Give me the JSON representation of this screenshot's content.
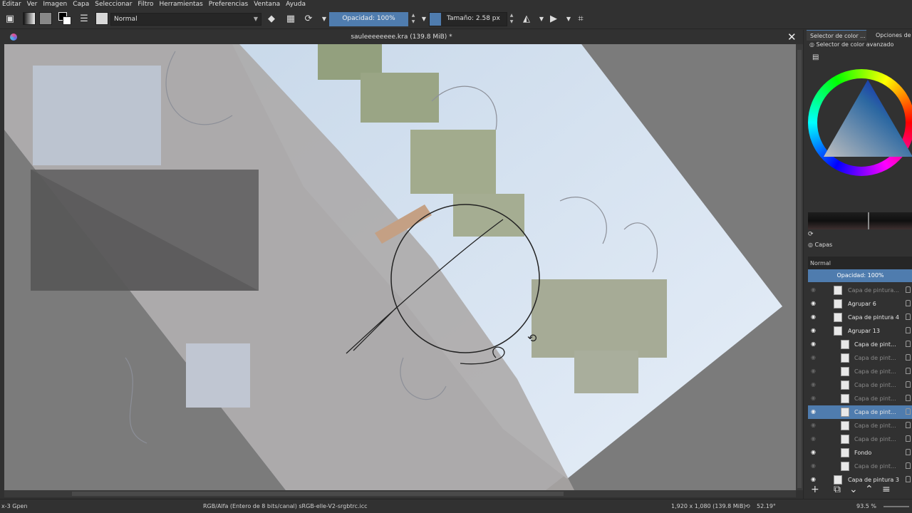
{
  "menu": [
    "Editar",
    "Ver",
    "Imagen",
    "Capa",
    "Seleccionar",
    "Filtro",
    "Herramientas",
    "Preferencias",
    "Ventana",
    "Ayuda"
  ],
  "toolbar": {
    "blend_mode": "Normal",
    "opacity_label": "Opacidad: 100%",
    "size_label": "Tamaño: 2.58 px",
    "icons": [
      "save-icon",
      "gradient-icon",
      "pattern-icon",
      "color-swap-icon",
      "brush-presets-icon",
      "brush-icon",
      "eraser-icon",
      "alpha-lock-icon",
      "reload-icon",
      "mirror-icon",
      "wrap-icon",
      "crop-icon"
    ]
  },
  "document": {
    "title": "sauleeeeeeee.kra (139.8 MiB) *"
  },
  "dock": {
    "tabs": [
      "Selector de color ...",
      "Opciones de"
    ],
    "color_selector_title": "Selector de color avanzado",
    "layers_title": "Capas",
    "layers_blend": "Normal",
    "layers_opacity": "Opacidad:  100%",
    "layers": [
      {
        "name": "Capa de pintura...",
        "visible": false,
        "dim": true,
        "indent": 0
      },
      {
        "name": "Agrupar 6",
        "visible": true,
        "dim": false,
        "indent": 0
      },
      {
        "name": "Capa de pintura 4",
        "visible": true,
        "dim": false,
        "indent": 0
      },
      {
        "name": "Agrupar 13",
        "visible": true,
        "dim": false,
        "indent": 0
      },
      {
        "name": "Capa de pint...",
        "visible": true,
        "dim": false,
        "indent": 1
      },
      {
        "name": "Capa de pint...",
        "visible": false,
        "dim": true,
        "indent": 1
      },
      {
        "name": "Capa de pint...",
        "visible": false,
        "dim": true,
        "indent": 1
      },
      {
        "name": "Capa de pint...",
        "visible": false,
        "dim": true,
        "indent": 1
      },
      {
        "name": "Capa de pint...",
        "visible": false,
        "dim": true,
        "indent": 1
      },
      {
        "name": "Capa de pint...",
        "visible": true,
        "dim": false,
        "indent": 1,
        "selected": true
      },
      {
        "name": "Capa de pint...",
        "visible": false,
        "dim": true,
        "indent": 1
      },
      {
        "name": "Capa de pint...",
        "visible": false,
        "dim": true,
        "indent": 1
      },
      {
        "name": "Fondo",
        "visible": true,
        "dim": false,
        "indent": 1
      },
      {
        "name": "Capa de pint...",
        "visible": false,
        "dim": true,
        "indent": 1
      },
      {
        "name": "Capa de pintura 3",
        "visible": true,
        "dim": false,
        "indent": 0
      }
    ]
  },
  "status": {
    "left": "x-3 Gpen",
    "color_space": "RGB/Alfa (Entero de 8 bits/canal)  sRGB-elle-V2-srgbtrc.icc",
    "dimensions": "1,920 x 1,080 (139.8 MiB)",
    "rotation": "52.19°",
    "zoom": "93.5 %"
  },
  "colors": {
    "accent": "#4f7cae",
    "panel": "#313131",
    "canvas_bg": "#7b7b7b"
  }
}
